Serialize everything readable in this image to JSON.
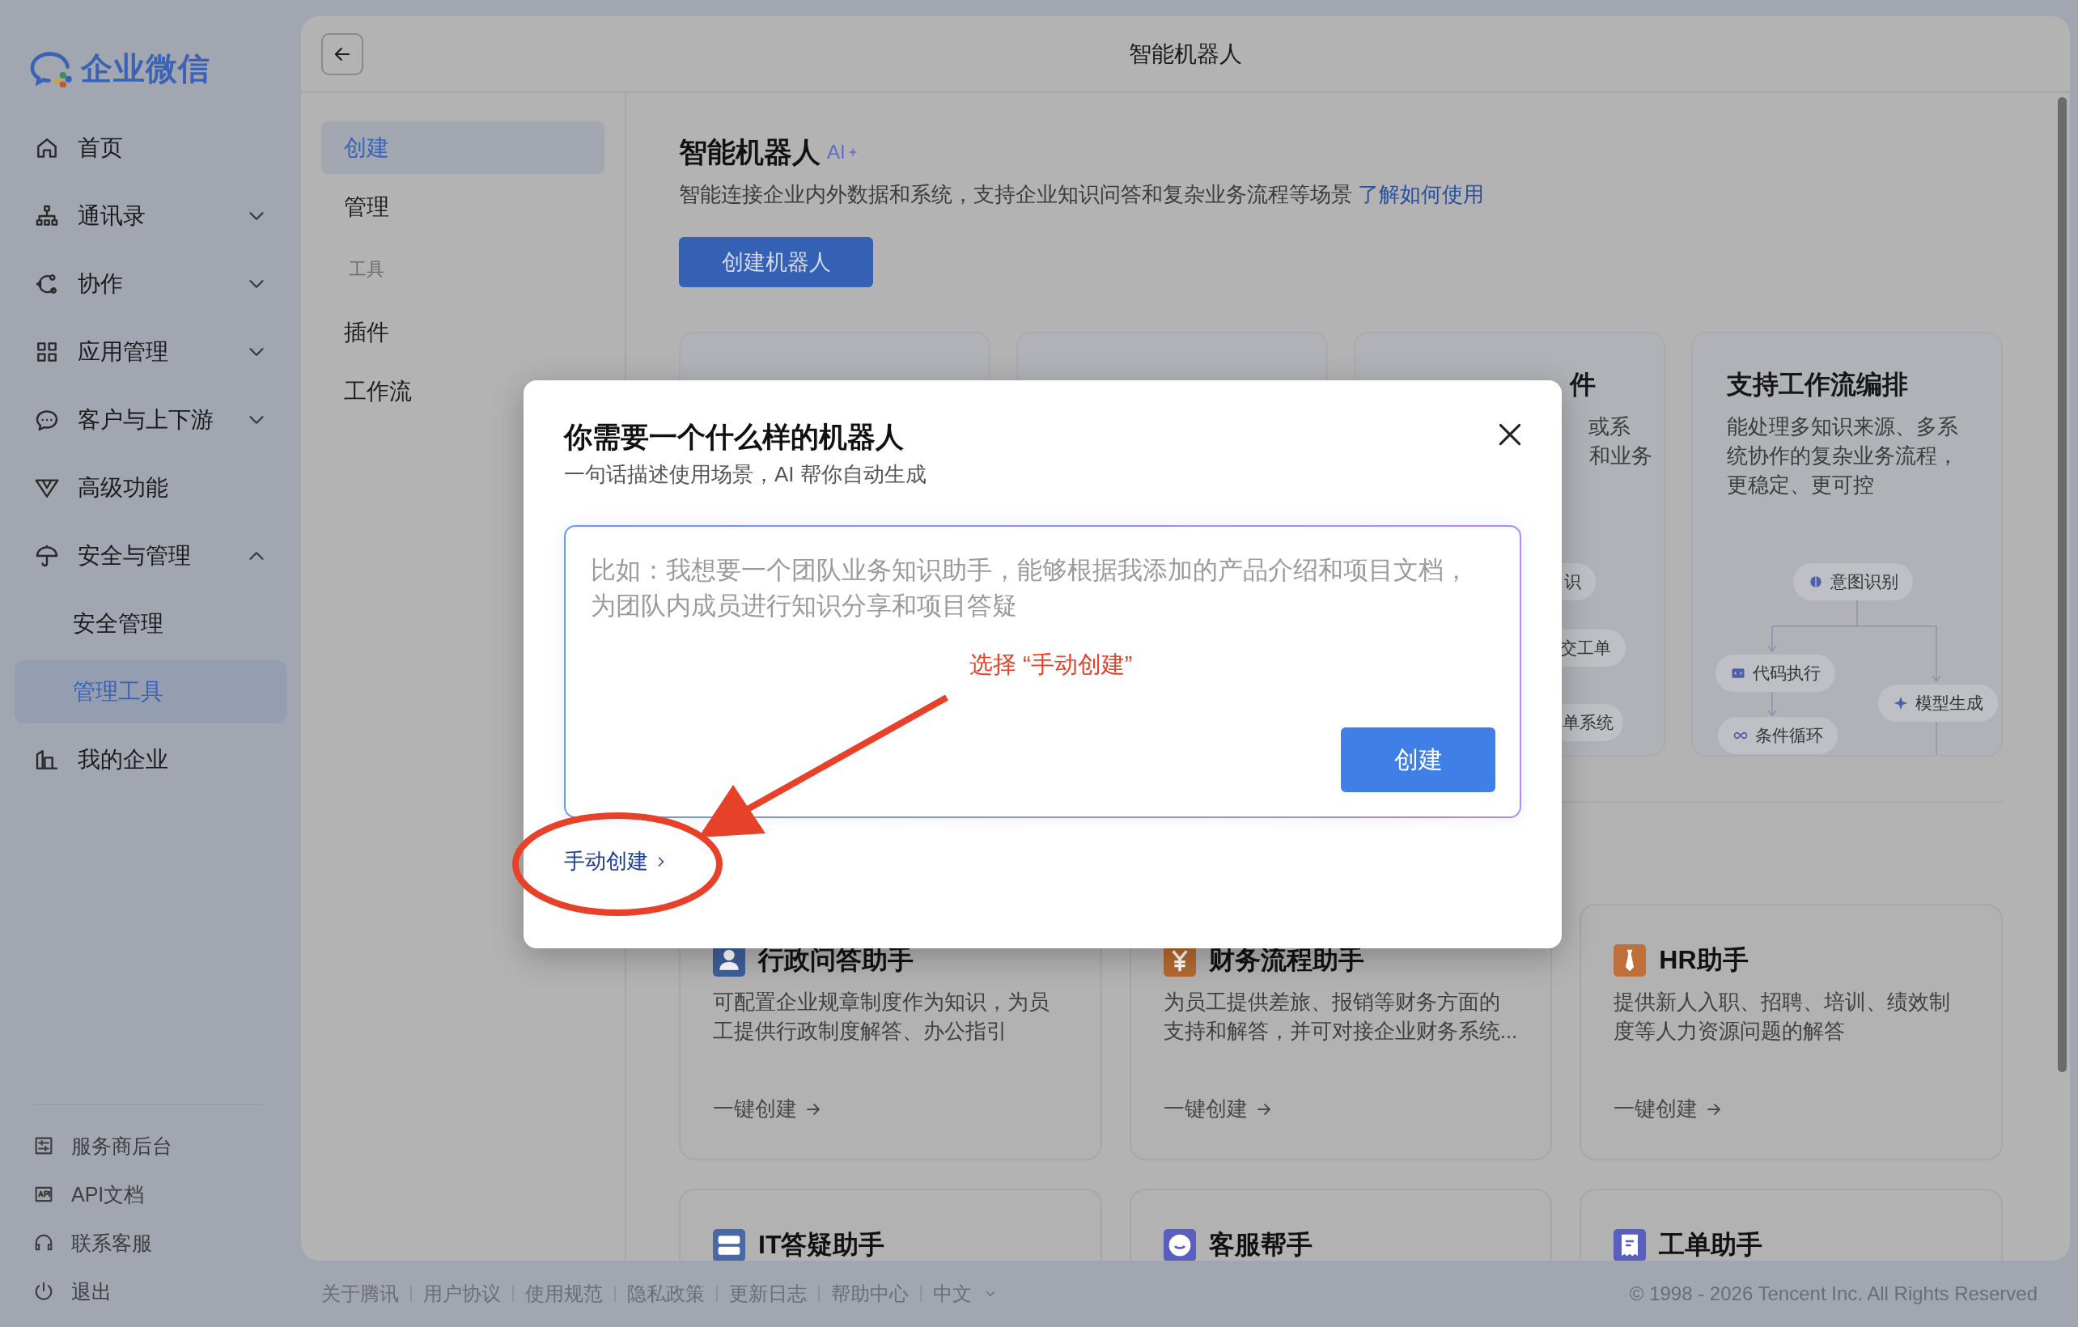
{
  "sidebar": {
    "logo": "企业微信",
    "nav": [
      {
        "label": "首页",
        "kind": "link",
        "selected": false
      },
      {
        "label": "通讯录",
        "kind": "group",
        "expanded": false,
        "selected": false
      },
      {
        "label": "协作",
        "kind": "group",
        "expanded": false,
        "selected": false
      },
      {
        "label": "应用管理",
        "kind": "group",
        "expanded": false,
        "selected": false
      },
      {
        "label": "客户与上下游",
        "kind": "group",
        "expanded": false,
        "selected": false
      },
      {
        "label": "高级功能",
        "kind": "link",
        "selected": false
      },
      {
        "label": "安全与管理",
        "kind": "group",
        "expanded": true,
        "selected": false,
        "children": [
          {
            "label": "安全管理",
            "selected": false
          },
          {
            "label": "管理工具",
            "selected": true
          }
        ]
      },
      {
        "label": "我的企业",
        "kind": "link",
        "selected": false
      }
    ],
    "bottom_links": [
      "服务商后台",
      "API文档",
      "联系客服",
      "退出"
    ]
  },
  "header": {
    "title": "智能机器人"
  },
  "subnav": [
    {
      "kind": "item",
      "label": "创建",
      "selected": true
    },
    {
      "kind": "item",
      "label": "管理",
      "selected": false
    },
    {
      "kind": "heading",
      "label": "工具"
    },
    {
      "kind": "item",
      "label": "插件",
      "selected": false
    },
    {
      "kind": "item",
      "label": "工作流",
      "selected": false
    }
  ],
  "content": {
    "title": "智能机器人",
    "badge": "AI",
    "description": "智能连接企业内外数据和系统，支持企业知识问答和复杂业务流程等场景",
    "help_link": "了解如何使用",
    "create_button": "创建机器人",
    "feature_cards": [
      {
        "kind": "covered"
      },
      {
        "kind": "covered"
      },
      {
        "kind": "open",
        "title_fragment": "件",
        "description_fragments": [
          "或系",
          "和业务"
        ],
        "chips": [
          "识",
          "交工单",
          "单系统"
        ]
      },
      {
        "kind": "open",
        "title": "支持工作流编排",
        "description": "能处理多知识来源、多系统协作的复杂业务流程，更稳定、更可控",
        "flow": [
          "意图识别",
          "代码执行",
          "模型生成",
          "条件循环"
        ]
      }
    ],
    "templates": [
      {
        "title": "行政问答助手",
        "color": "#3e5f9c",
        "description": "可配置企业规章制度作为知识，为员工提供行政制度解答、办公指引",
        "action": "一键创建"
      },
      {
        "title": "财务流程助手",
        "color": "#b5692f",
        "description": "为员工提供差旅、报销等财务方面的支持和解答，并可对接企业财务系统...",
        "action": "一键创建"
      },
      {
        "title": "HR助手",
        "color": "#c06f38",
        "description": "提供新人入职、招聘、培训、绩效制度等人力资源问题的解答",
        "action": "一键创建"
      },
      {
        "title": "IT答疑助手",
        "color": "#4968a6"
      },
      {
        "title": "客服帮手",
        "color": "#5a5fbf"
      },
      {
        "title": "工单助手",
        "color": "#5a5fbf"
      }
    ]
  },
  "dialog": {
    "title": "你需要一个什么样的机器人",
    "subtitle": "一句话描述使用场景，AI 帮你自动生成",
    "placeholder": "比如：我想要一个团队业务知识助手，能够根据我添加的产品介绍和项目文档，为团队内成员进行知识分享和项目答疑",
    "submit": "创建",
    "manual_link": "手动创建"
  },
  "annotation": {
    "text": "选择 “手动创建”"
  },
  "footer": {
    "links": [
      "关于腾讯",
      "用户协议",
      "使用规范",
      "隐私政策",
      "更新日志",
      "帮助中心"
    ],
    "language": "中文",
    "copyright": "© 1998 - 2026 Tencent Inc. All Rights Reserved"
  }
}
